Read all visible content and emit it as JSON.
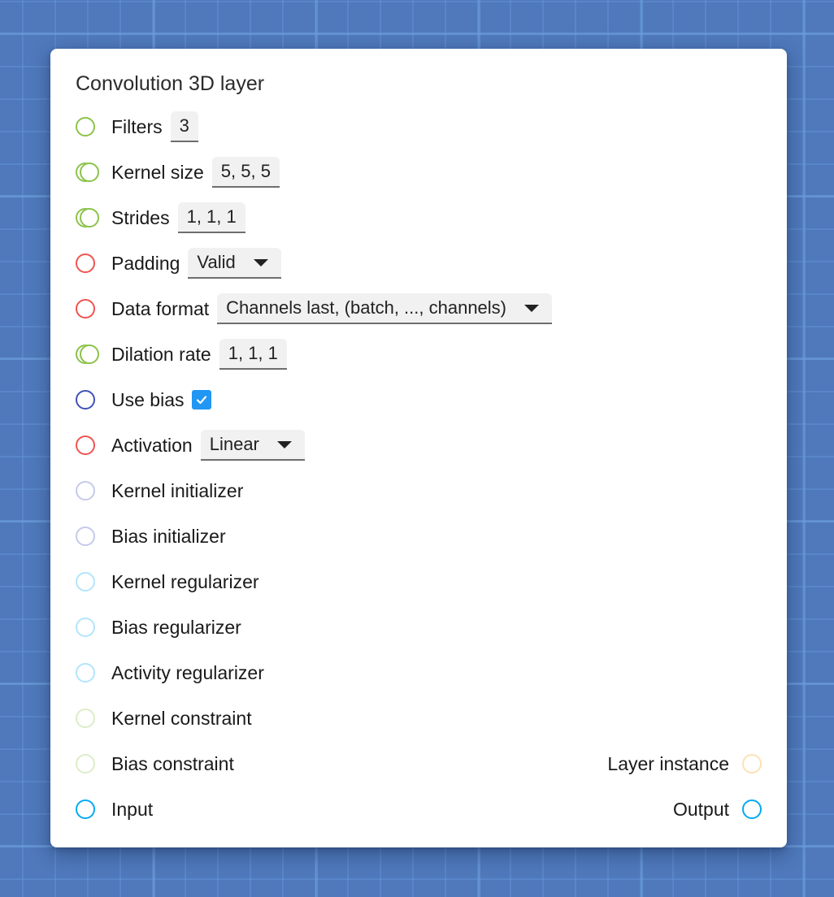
{
  "node": {
    "title": "Convolution 3D layer",
    "params": [
      {
        "id": "filters",
        "label": "Filters",
        "port": "single",
        "port_color": "#8bc34a",
        "control": "input",
        "value": "3"
      },
      {
        "id": "kernel-size",
        "label": "Kernel size",
        "port": "double",
        "port_color": "#8bc34a",
        "control": "input",
        "value": "5, 5, 5"
      },
      {
        "id": "strides",
        "label": "Strides",
        "port": "double",
        "port_color": "#8bc34a",
        "control": "input",
        "value": "1, 1, 1"
      },
      {
        "id": "padding",
        "label": "Padding",
        "port": "single",
        "port_color": "#ef5350",
        "control": "select",
        "value": "Valid"
      },
      {
        "id": "data-format",
        "label": "Data format",
        "port": "single",
        "port_color": "#ef5350",
        "control": "select",
        "value": "Channels last, (batch, ..., channels)"
      },
      {
        "id": "dilation-rate",
        "label": "Dilation rate",
        "port": "double",
        "port_color": "#8bc34a",
        "control": "input",
        "value": "1, 1, 1"
      },
      {
        "id": "use-bias",
        "label": "Use bias",
        "port": "single",
        "port_color": "#3f51b5",
        "control": "checkbox",
        "checked": true
      },
      {
        "id": "activation",
        "label": "Activation",
        "port": "single",
        "port_color": "#ef5350",
        "control": "select",
        "value": "Linear"
      },
      {
        "id": "kernel-initializer",
        "label": "Kernel initializer",
        "port": "single",
        "port_color": "#c5cae9",
        "control": "none"
      },
      {
        "id": "bias-initializer",
        "label": "Bias initializer",
        "port": "single",
        "port_color": "#c5cae9",
        "control": "none"
      },
      {
        "id": "kernel-regularizer",
        "label": "Kernel regularizer",
        "port": "single",
        "port_color": "#b3e5fc",
        "control": "none"
      },
      {
        "id": "bias-regularizer",
        "label": "Bias regularizer",
        "port": "single",
        "port_color": "#b3e5fc",
        "control": "none"
      },
      {
        "id": "activity-regularizer",
        "label": "Activity regularizer",
        "port": "single",
        "port_color": "#b3e5fc",
        "control": "none"
      },
      {
        "id": "kernel-constraint",
        "label": "Kernel constraint",
        "port": "single",
        "port_color": "#dcedc8",
        "control": "none"
      },
      {
        "id": "bias-constraint",
        "label": "Bias constraint",
        "port": "single",
        "port_color": "#dcedc8",
        "control": "none"
      },
      {
        "id": "input",
        "label": "Input",
        "port": "single",
        "port_color": "#03a9f4",
        "control": "none"
      }
    ],
    "outputs": [
      {
        "id": "layer-instance",
        "label": "Layer instance",
        "port_color": "#ffe0b2"
      },
      {
        "id": "output",
        "label": "Output",
        "port_color": "#03a9f4"
      }
    ]
  },
  "icons": {
    "port": "circle-port-icon",
    "multi_port": "double-circle-port-icon",
    "caret": "caret-down-icon",
    "check": "checkmark-icon"
  }
}
